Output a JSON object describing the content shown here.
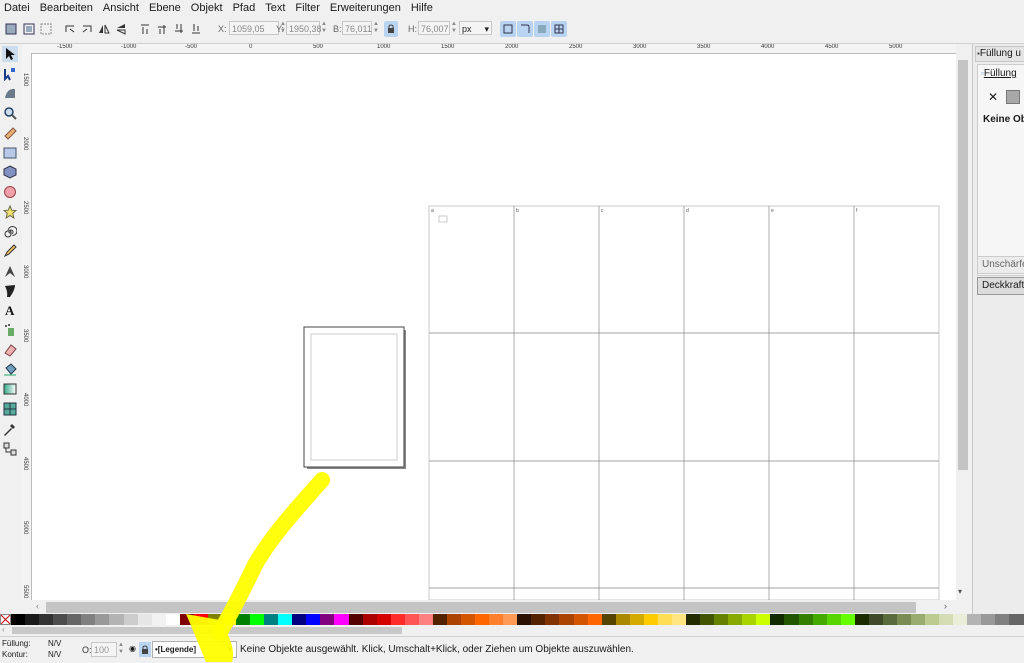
{
  "menu": [
    "Datei",
    "Bearbeiten",
    "Ansicht",
    "Ebene",
    "Objekt",
    "Pfad",
    "Text",
    "Filter",
    "Erweiterungen",
    "Hilfe"
  ],
  "toolbar": {
    "x_label": "X:",
    "x_value": "1059,05",
    "y_label": "Y:",
    "y_value": "1950,38",
    "w_label": "B:",
    "w_value": "76,011",
    "h_label": "H:",
    "h_value": "76,007",
    "unit": "px"
  },
  "ruler": {
    "h_ticks": [
      "-1500",
      "-1000",
      "-500",
      "0",
      "500",
      "1000",
      "1500",
      "2000",
      "2500",
      "3000",
      "3500",
      "4000",
      "4500",
      "5000"
    ],
    "v_ticks": [
      "1500",
      "2000",
      "2500",
      "3000",
      "3500",
      "4000",
      "4500",
      "5000",
      "5500"
    ]
  },
  "grid": {
    "column_labels": [
      "a",
      "b",
      "c",
      "d",
      "e",
      "f"
    ]
  },
  "dock": {
    "tab_title": "Füllung u",
    "fill_tab": "Füllung",
    "x_symbol": "✕",
    "no_objects": "Keine Obj",
    "blur_label": "Unschärfe",
    "opacity_label": "Deckkraft"
  },
  "palette_colors": [
    "#000000",
    "#1a1a1a",
    "#333333",
    "#4d4d4d",
    "#666666",
    "#808080",
    "#999999",
    "#b3b3b3",
    "#cccccc",
    "#e6e6e6",
    "#f2f2f2",
    "#ffffff",
    "#800000",
    "#ff0000",
    "#808000",
    "#ffff00",
    "#008000",
    "#00ff00",
    "#008080",
    "#00ffff",
    "#000080",
    "#0000ff",
    "#800080",
    "#ff00ff",
    "#550000",
    "#aa0000",
    "#d40000",
    "#ff2a2a",
    "#ff5555",
    "#ff8080",
    "#552200",
    "#aa4400",
    "#d45500",
    "#ff6600",
    "#ff7f2a",
    "#ff9955",
    "#2b1100",
    "#552200",
    "#803300",
    "#aa4400",
    "#d45500",
    "#ff6600",
    "#554400",
    "#aa8800",
    "#d4aa00",
    "#ffcc00",
    "#ffdd55",
    "#ffe680",
    "#222b00",
    "#445500",
    "#668000",
    "#88aa00",
    "#aad400",
    "#ccff00",
    "#112b00",
    "#225500",
    "#338000",
    "#44aa00",
    "#55d400",
    "#66ff00",
    "#1c2b00",
    "#3e4a2a",
    "#5a6b3d",
    "#7a8c54",
    "#9aad6e",
    "#bccc8e",
    "#d4dcb4",
    "#eaeed8",
    "#b3b3b3",
    "#999999",
    "#808080",
    "#666666"
  ],
  "status": {
    "fill_label": "Füllung:",
    "fill_value": "N/V",
    "stroke_label": "Kontur:",
    "stroke_value": "N/V",
    "opacity_label": "O:",
    "opacity_value": "100",
    "layer_name": "•[Legende]",
    "message": "Keine Objekte ausgewählt. Klick, Umschalt+Klick, oder Ziehen um Objekte auszuwählen."
  }
}
